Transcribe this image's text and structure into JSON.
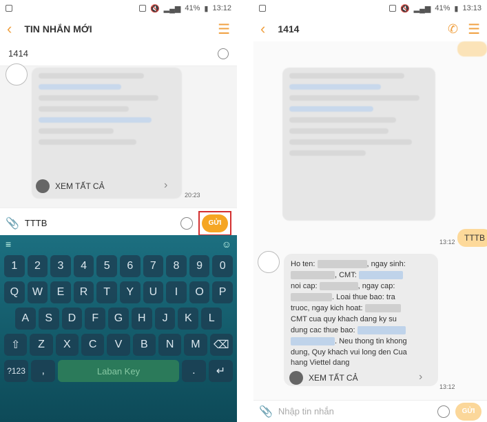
{
  "left": {
    "status": {
      "battery": "41%",
      "time": "13:12"
    },
    "title": "TIN NHẮN MỚI",
    "recipient": "1414",
    "see_all": "XEM TẤT CẢ",
    "msg_time": "20:23",
    "input_text": "TTTB",
    "send_label": "GỬI",
    "keyboard": {
      "rows": [
        [
          "1",
          "2",
          "3",
          "4",
          "5",
          "6",
          "7",
          "8",
          "9",
          "0"
        ],
        [
          "Q",
          "W",
          "E",
          "R",
          "T",
          "Y",
          "U",
          "I",
          "O",
          "P"
        ],
        [
          "A",
          "S",
          "D",
          "F",
          "G",
          "H",
          "J",
          "K",
          "L"
        ],
        [
          "⇧",
          "Z",
          "X",
          "C",
          "V",
          "B",
          "N",
          "M",
          "⌫"
        ]
      ],
      "bottom": [
        "?123",
        ",",
        "Laban Key",
        ".",
        "↵"
      ]
    }
  },
  "right": {
    "status": {
      "battery": "41%",
      "time": "13:13"
    },
    "title": "1414",
    "sent_text": "TTTB",
    "sent_time": "13:12",
    "reply": {
      "l1": "Ho ten:",
      "l1b": ", ngay sinh:",
      "l2": ", CMT:",
      "l3": "noi cap:",
      "l3b": ", ngay cap:",
      "l4": ". Loai thue bao: tra",
      "l5": "truoc, ngay kich hoat:",
      "l6": "CMT cua quy khach dang ky su",
      "l7": "dung cac thue bao:",
      "l8": ". Neu thong tin khong",
      "l9": "dung, Quy khach vui long den Cua",
      "l10": "hang Viettel dang"
    },
    "see_all": "XEM TẤT CẢ",
    "reply_time": "13:12",
    "placeholder": "Nhập tin nhắn",
    "send_label": "GỬI"
  }
}
